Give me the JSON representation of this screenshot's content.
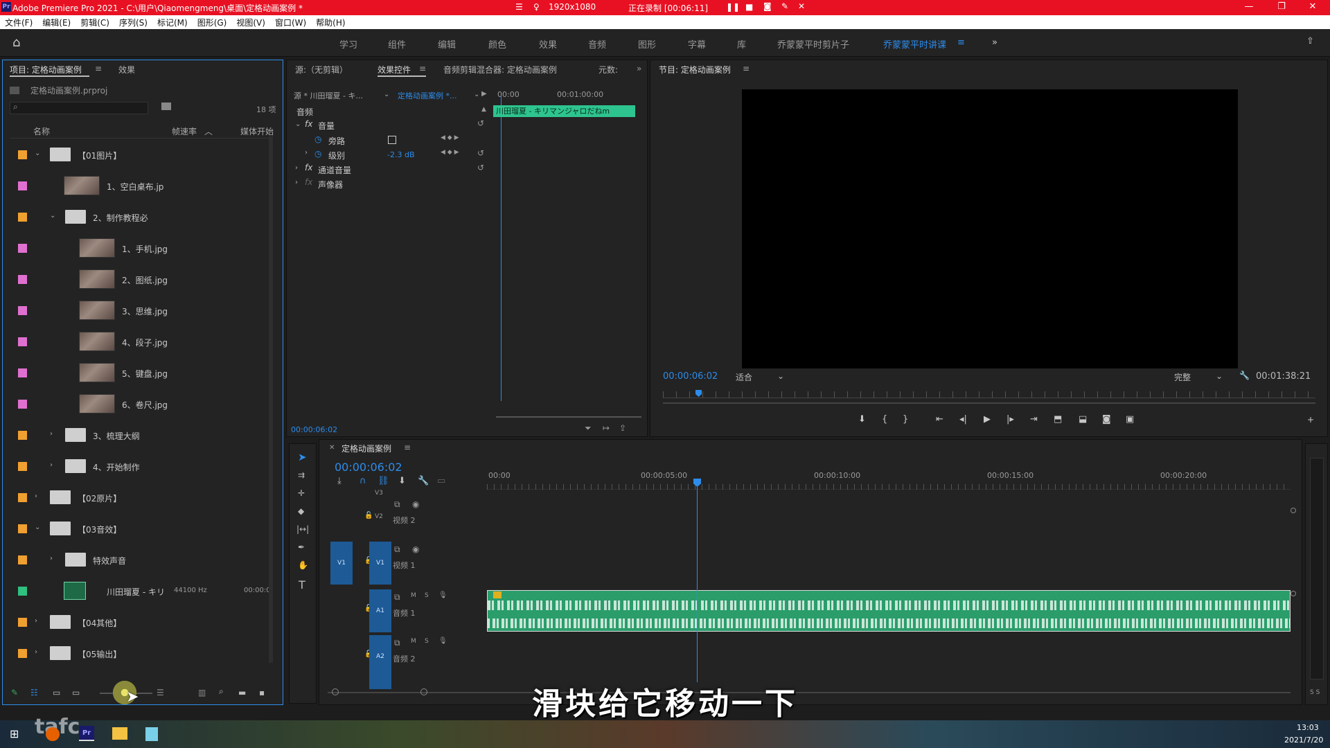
{
  "titlebar": {
    "title": "Adobe Premiere Pro 2021 - C:\\用户\\Qiaomengmeng\\桌面\\定格动画案例 *",
    "resolution": "1920x1080",
    "recording": "正在录制 [00:06:11]"
  },
  "menu": [
    "文件(F)",
    "编辑(E)",
    "剪辑(C)",
    "序列(S)",
    "标记(M)",
    "图形(G)",
    "视图(V)",
    "窗口(W)",
    "帮助(H)"
  ],
  "workspaces": [
    "学习",
    "组件",
    "编辑",
    "颜色",
    "效果",
    "音频",
    "图形",
    "字幕",
    "库",
    "乔蒙蒙平时剪片子",
    "乔蒙蒙平时讲课"
  ],
  "project": {
    "tab": "项目: 定格动画案例",
    "tab2": "效果",
    "file": "定格动画案例.prproj",
    "count": "18 项",
    "col_name": "名称",
    "col_rate": "帧速率",
    "col_media": "媒体开始",
    "items": [
      {
        "label": "【01图片】",
        "kind": "folder",
        "color": "#f0a030",
        "indent": 0,
        "exp": "v"
      },
      {
        "label": "1、空白桌布.jp",
        "kind": "thumb",
        "color": "#e070d0",
        "indent": 1,
        "exp": ""
      },
      {
        "label": "2、制作教程必",
        "kind": "folder",
        "color": "#f0a030",
        "indent": 1,
        "exp": "v"
      },
      {
        "label": "1、手机.jpg",
        "kind": "thumb",
        "color": "#e070d0",
        "indent": 2,
        "exp": ""
      },
      {
        "label": "2、图纸.jpg",
        "kind": "thumb",
        "color": "#e070d0",
        "indent": 2,
        "exp": ""
      },
      {
        "label": "3、思维.jpg",
        "kind": "thumb",
        "color": "#e070d0",
        "indent": 2,
        "exp": ""
      },
      {
        "label": "4、段子.jpg",
        "kind": "thumb",
        "color": "#e070d0",
        "indent": 2,
        "exp": ""
      },
      {
        "label": "5、键盘.jpg",
        "kind": "thumb",
        "color": "#e070d0",
        "indent": 2,
        "exp": ""
      },
      {
        "label": "6、卷尺.jpg",
        "kind": "thumb",
        "color": "#e070d0",
        "indent": 2,
        "exp": ""
      },
      {
        "label": "3、梳理大纲",
        "kind": "folder",
        "color": "#f0a030",
        "indent": 1,
        "exp": ">"
      },
      {
        "label": "4、开始制作",
        "kind": "folder",
        "color": "#f0a030",
        "indent": 1,
        "exp": ">"
      },
      {
        "label": "【02原片】",
        "kind": "folder",
        "color": "#f0a030",
        "indent": 0,
        "exp": ">"
      },
      {
        "label": "【03音效】",
        "kind": "folder",
        "color": "#f0a030",
        "indent": 0,
        "exp": "v"
      },
      {
        "label": "特效声音",
        "kind": "folder",
        "color": "#f0a030",
        "indent": 1,
        "exp": ">"
      },
      {
        "label": "川田瑠夏 - キリ",
        "kind": "audio",
        "color": "#30c080",
        "indent": 1,
        "exp": "",
        "rate": "44100 Hz",
        "start": "00:00:0"
      },
      {
        "label": "【04其他】",
        "kind": "folder",
        "color": "#f0a030",
        "indent": 0,
        "exp": ">"
      },
      {
        "label": "【05输出】",
        "kind": "folder",
        "color": "#f0a030",
        "indent": 0,
        "exp": ">"
      }
    ]
  },
  "effects": {
    "tab_source": "源:（无剪辑）",
    "tab_effects": "效果控件",
    "tab_mixer": "音频剪辑混合器: 定格动画案例",
    "tab_meta": "元数:",
    "src_clip": "源 * 川田瑠夏 - キ...",
    "seq_clip": "定格动画案例 *...",
    "tc_start": "00:00",
    "tc_mid": "00:01:00:00",
    "clip_label": "川田瑠夏 - キリマンジャロだねm",
    "section": "音频",
    "fx_volume": "音量",
    "bypass": "旁路",
    "level": "级别",
    "level_val": "-2.3 dB",
    "fx_channel": "通道音量",
    "fx_panner": "声像器",
    "timecode": "00:00:06:02"
  },
  "program": {
    "tab": "节目: 定格动画案例",
    "timecode": "00:00:06:02",
    "fit": "适合",
    "quality": "完整",
    "duration": "00:01:38:21"
  },
  "timeline": {
    "tab": "定格动画案例",
    "timecode": "00:00:06:02",
    "ruler": [
      "00:00",
      "00:00:05:00",
      "00:00:10:00",
      "00:00:15:00",
      "00:00:20:00"
    ],
    "tracks": [
      {
        "id": "V3",
        "name": ""
      },
      {
        "id": "V2",
        "name": "视频 2"
      },
      {
        "id": "V1",
        "name": "视频 1"
      },
      {
        "id": "A1",
        "name": "音频 1"
      },
      {
        "id": "A2",
        "name": "音频 2"
      }
    ],
    "src_v1": "V1",
    "meter": "S S"
  },
  "subtitle": "滑块给它移动一下",
  "clock": {
    "time": "13:03",
    "date": "2021/7/20"
  },
  "watermark": "tafc"
}
